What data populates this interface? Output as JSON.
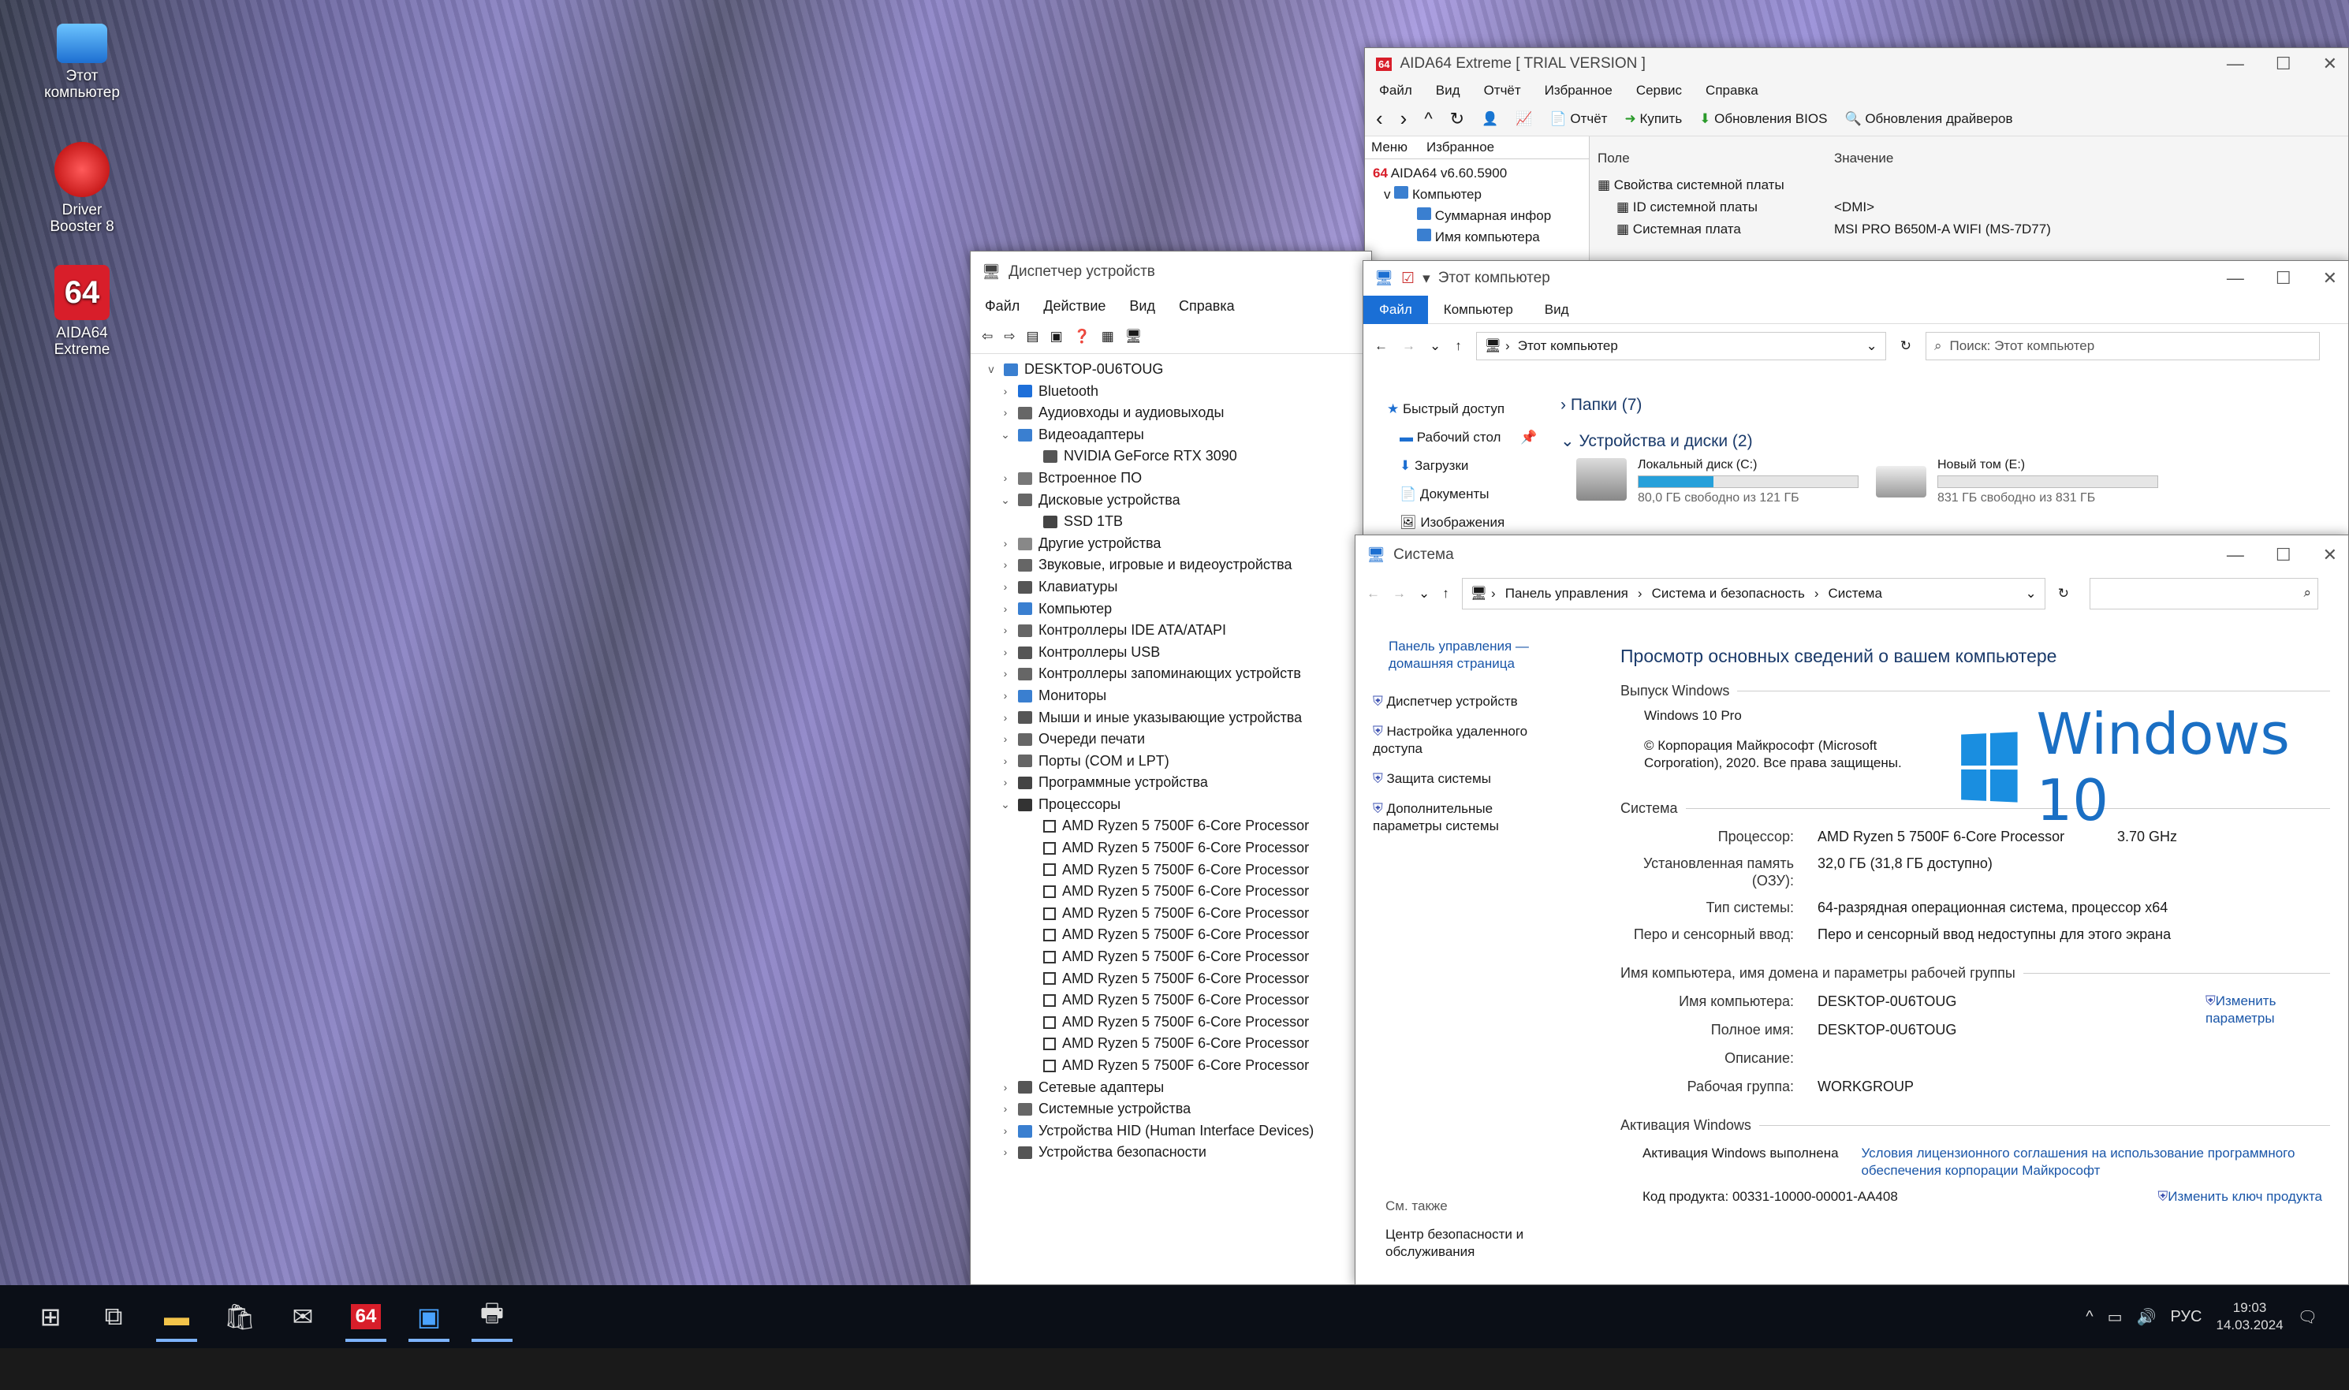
{
  "desktop": {
    "icons": [
      {
        "label": "Этот компьютер"
      },
      {
        "label": "Driver Booster 8"
      },
      {
        "label": "AIDA64 Extreme"
      }
    ]
  },
  "aida": {
    "title": "AIDA64 Extreme  [ TRIAL VERSION ]",
    "menu": [
      "Файл",
      "Вид",
      "Отчёт",
      "Избранное",
      "Сервис",
      "Справка"
    ],
    "toolbar": {
      "report": "Отчёт",
      "buy": "Купить",
      "bios": "Обновления BIOS",
      "drivers": "Обновления драйверов"
    },
    "tabs": [
      "Меню",
      "Избранное"
    ],
    "tree": [
      "AIDA64 v6.60.5900",
      "Компьютер",
      "Суммарная инфор",
      "Имя компьютера"
    ],
    "cols": {
      "field": "Поле",
      "value": "Значение"
    },
    "rows": [
      {
        "field": "Свойства системной платы",
        "value": ""
      },
      {
        "field": "ID системной платы",
        "value": "<DMI>"
      },
      {
        "field": "Системная плата",
        "value": "MSI PRO B650M-A WIFI (MS-7D77)"
      }
    ]
  },
  "devmgr": {
    "title": "Диспетчер устройств",
    "menu": [
      "Файл",
      "Действие",
      "Вид",
      "Справка"
    ],
    "root": "DESKTOP-0U6TOUG",
    "items": [
      {
        "label": "Bluetooth",
        "level": 1,
        "tw": ">"
      },
      {
        "label": "Аудиовходы и аудиовыходы",
        "level": 1,
        "tw": ">"
      },
      {
        "label": "Видеоадаптеры",
        "level": 1,
        "tw": "v"
      },
      {
        "label": "NVIDIA GeForce RTX 3090",
        "level": 2,
        "tw": ""
      },
      {
        "label": "Встроенное ПО",
        "level": 1,
        "tw": ">"
      },
      {
        "label": "Дисковые устройства",
        "level": 1,
        "tw": "v"
      },
      {
        "label": "SSD 1TB",
        "level": 2,
        "tw": ""
      },
      {
        "label": "Другие устройства",
        "level": 1,
        "tw": ">"
      },
      {
        "label": "Звуковые, игровые и видеоустройства",
        "level": 1,
        "tw": ">"
      },
      {
        "label": "Клавиатуры",
        "level": 1,
        "tw": ">"
      },
      {
        "label": "Компьютер",
        "level": 1,
        "tw": ">"
      },
      {
        "label": "Контроллеры IDE ATA/ATAPI",
        "level": 1,
        "tw": ">"
      },
      {
        "label": "Контроллеры USB",
        "level": 1,
        "tw": ">"
      },
      {
        "label": "Контроллеры запоминающих устройств",
        "level": 1,
        "tw": ">"
      },
      {
        "label": "Мониторы",
        "level": 1,
        "tw": ">"
      },
      {
        "label": "Мыши и иные указывающие устройства",
        "level": 1,
        "tw": ">"
      },
      {
        "label": "Очереди печати",
        "level": 1,
        "tw": ">"
      },
      {
        "label": "Порты (COM и LPT)",
        "level": 1,
        "tw": ">"
      },
      {
        "label": "Программные устройства",
        "level": 1,
        "tw": ">"
      },
      {
        "label": "Процессоры",
        "level": 1,
        "tw": "v"
      },
      {
        "label": "AMD Ryzen 5 7500F 6-Core Processor",
        "level": 2,
        "tw": "",
        "proc": true
      },
      {
        "label": "AMD Ryzen 5 7500F 6-Core Processor",
        "level": 2,
        "tw": "",
        "proc": true
      },
      {
        "label": "AMD Ryzen 5 7500F 6-Core Processor",
        "level": 2,
        "tw": "",
        "proc": true
      },
      {
        "label": "AMD Ryzen 5 7500F 6-Core Processor",
        "level": 2,
        "tw": "",
        "proc": true
      },
      {
        "label": "AMD Ryzen 5 7500F 6-Core Processor",
        "level": 2,
        "tw": "",
        "proc": true
      },
      {
        "label": "AMD Ryzen 5 7500F 6-Core Processor",
        "level": 2,
        "tw": "",
        "proc": true
      },
      {
        "label": "AMD Ryzen 5 7500F 6-Core Processor",
        "level": 2,
        "tw": "",
        "proc": true
      },
      {
        "label": "AMD Ryzen 5 7500F 6-Core Processor",
        "level": 2,
        "tw": "",
        "proc": true
      },
      {
        "label": "AMD Ryzen 5 7500F 6-Core Processor",
        "level": 2,
        "tw": "",
        "proc": true
      },
      {
        "label": "AMD Ryzen 5 7500F 6-Core Processor",
        "level": 2,
        "tw": "",
        "proc": true
      },
      {
        "label": "AMD Ryzen 5 7500F 6-Core Processor",
        "level": 2,
        "tw": "",
        "proc": true
      },
      {
        "label": "AMD Ryzen 5 7500F 6-Core Processor",
        "level": 2,
        "tw": "",
        "proc": true
      },
      {
        "label": "Сетевые адаптеры",
        "level": 1,
        "tw": ">"
      },
      {
        "label": "Системные устройства",
        "level": 1,
        "tw": ">"
      },
      {
        "label": "Устройства HID (Human Interface Devices)",
        "level": 1,
        "tw": ">"
      },
      {
        "label": "Устройства безопасности",
        "level": 1,
        "tw": ">"
      }
    ]
  },
  "explorer": {
    "title": "Этот компьютер",
    "ribbon": [
      "Файл",
      "Компьютер",
      "Вид"
    ],
    "address": "Этот компьютер",
    "search": "Поиск: Этот компьютер",
    "nav": [
      "Быстрый доступ",
      "Рабочий стол",
      "Загрузки",
      "Документы",
      "Изображения"
    ],
    "folders": "Папки (7)",
    "devices": "Устройства и диски (2)",
    "drives": [
      {
        "name": "Локальный диск (C:)",
        "free": "80,0 ГБ свободно из 121 ГБ",
        "used": 0.34
      },
      {
        "name": "Новый том (E:)",
        "free": "831 ГБ свободно из 831 ГБ",
        "used": 0.0
      }
    ]
  },
  "system": {
    "title": "Система",
    "breadcrumb": [
      "Панель управления",
      "Система и безопасность",
      "Система"
    ],
    "side": {
      "home": "Панель управления — домашняя страница",
      "links": [
        "Диспетчер устройств",
        "Настройка удаленного доступа",
        "Защита системы",
        "Дополнительные параметры системы"
      ],
      "see_also": "См. также",
      "security": "Центр безопасности и обслуживания"
    },
    "heading": "Просмотр основных сведений о вашем компьютере",
    "edition_section": "Выпуск Windows",
    "edition": "Windows 10 Pro",
    "copyright": "© Корпорация Майкрософт (Microsoft Corporation), 2020. Все права защищены.",
    "logo_text": "Windows 10",
    "system_section": "Система",
    "specs": [
      {
        "k": "Процессор:",
        "v": "AMD Ryzen 5 7500F 6-Core Processor",
        "extra": "3.70 GHz"
      },
      {
        "k": "Установленная память (ОЗУ):",
        "v": "32,0 ГБ (31,8 ГБ доступно)",
        "extra": ""
      },
      {
        "k": "Тип системы:",
        "v": "64-разрядная операционная система, процессор x64",
        "extra": ""
      },
      {
        "k": "Перо и сенсорный ввод:",
        "v": "Перо и сенсорный ввод недоступны для этого экрана",
        "extra": ""
      }
    ],
    "name_section": "Имя компьютера, имя домена и параметры рабочей группы",
    "names": [
      {
        "k": "Имя компьютера:",
        "v": "DESKTOP-0U6TOUG"
      },
      {
        "k": "Полное имя:",
        "v": "DESKTOP-0U6TOUG"
      },
      {
        "k": "Описание:",
        "v": ""
      },
      {
        "k": "Рабочая группа:",
        "v": "WORKGROUP"
      }
    ],
    "change": "Изменить параметры",
    "activation_section": "Активация Windows",
    "activated": "Активация Windows выполнена",
    "license": "Условия лицензионного соглашения на использование программного обеспечения корпорации Майкрософт",
    "product_label": "Код продукта:",
    "product": "00331-10000-00001-AA408",
    "change_key": "Изменить ключ продукта"
  },
  "tray": {
    "lang": "РУС",
    "time": "19:03",
    "date": "14.03.2024"
  }
}
